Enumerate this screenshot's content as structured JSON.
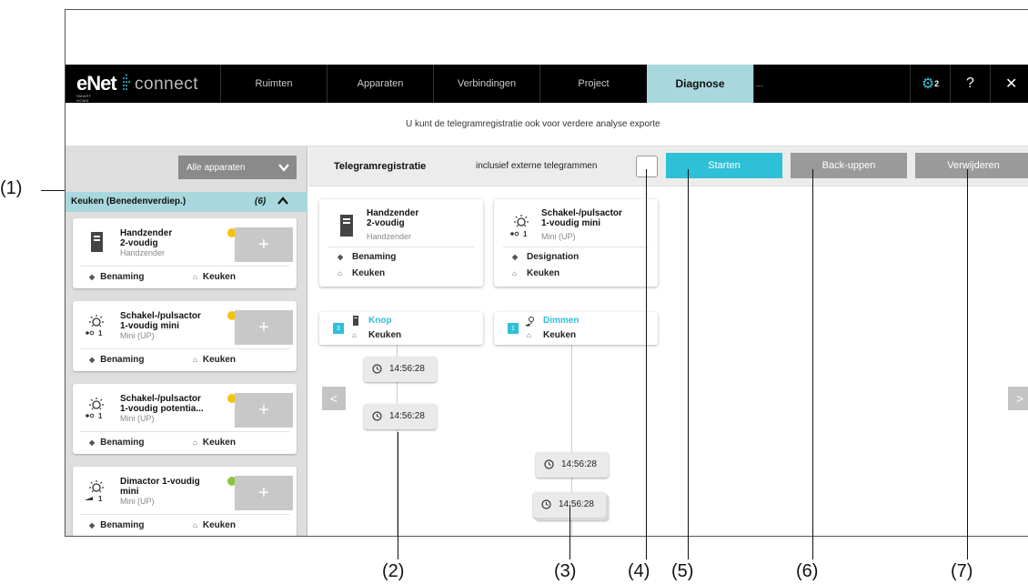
{
  "nav": {
    "logo_main": "eNet",
    "logo_sub": "SMART HOME",
    "logo_product": "connect",
    "tabs": [
      "Ruimten",
      "Apparaten",
      "Verbindingen",
      "Project",
      "Diagnose"
    ],
    "overflow": "...",
    "settings_badge": "2",
    "help": "?",
    "close": "✕"
  },
  "info_text": "U kunt de telegramregistratie ook voor verdere analyse exporte",
  "sidebar": {
    "filter_label": "Alle apparaten",
    "group": {
      "name": "Keuken (Benedenverdiep.)",
      "count": "(6)"
    },
    "devices": [
      {
        "title1": "Handzender",
        "title2": "2-voudig",
        "subtitle": "Handzender",
        "status_color": "#f4c30c",
        "tag": "Benaming",
        "room": "Keuken",
        "icon": "hand-transmitter-icon"
      },
      {
        "title1": "Schakel-/pulsactor",
        "title2": "1-voudig mini",
        "subtitle": "Mini (UP)",
        "status_color": "#f4c30c",
        "tag": "Benaming",
        "room": "Keuken",
        "icon": "light-switch-actuator-icon"
      },
      {
        "title1": "Schakel-/pulsactor",
        "title2": "1-voudig potentia...",
        "subtitle": "Mini (UP)",
        "status_color": "#f4c30c",
        "tag": "Benaming",
        "room": "Keuken",
        "icon": "light-switch-actuator-icon"
      },
      {
        "title1": "Dimactor 1-voudig",
        "title2": "mini",
        "subtitle": "Mini (UP)",
        "status_color": "#8cc63f",
        "tag": "Benaming",
        "room": "Keuken",
        "icon": "dimmer-actuator-icon"
      }
    ],
    "add_label": "+"
  },
  "toolbar": {
    "title": "Telegramregistratie",
    "include_label": "inclusief externe telegrammen",
    "start_label": "Starten",
    "backup_label": "Back-uppen",
    "delete_label": "Verwijderen"
  },
  "diagram": {
    "sources": [
      {
        "title1": "Handzender",
        "title2": "2-voudig",
        "subtitle": "Handzender",
        "tag": "Benaming",
        "room": "Keuken"
      },
      {
        "title1": "Schakel-/pulsactor",
        "title2": "1-voudig mini",
        "subtitle": "Mini (UP)",
        "tag": "Designation",
        "room": "Keuken"
      }
    ],
    "channels": [
      {
        "number": "3",
        "name": "Knop",
        "room": "Keuken"
      },
      {
        "number": "1",
        "name": "Dimmen",
        "room": "Keuken"
      }
    ],
    "timestamps": [
      "14:56:28",
      "14:56:28",
      "14:56:28",
      "14:56:28"
    ],
    "prev_arrow": "<",
    "next_arrow": ">"
  },
  "callouts": [
    "(1)",
    "(2)",
    "(3)",
    "(4)",
    "(5)",
    "(6)",
    "(7)"
  ],
  "colors": {
    "accent": "#2ec0d6",
    "active_tab": "#a8d8dd",
    "nav_bg": "#000000",
    "button_grey": "#9a9a9a"
  }
}
